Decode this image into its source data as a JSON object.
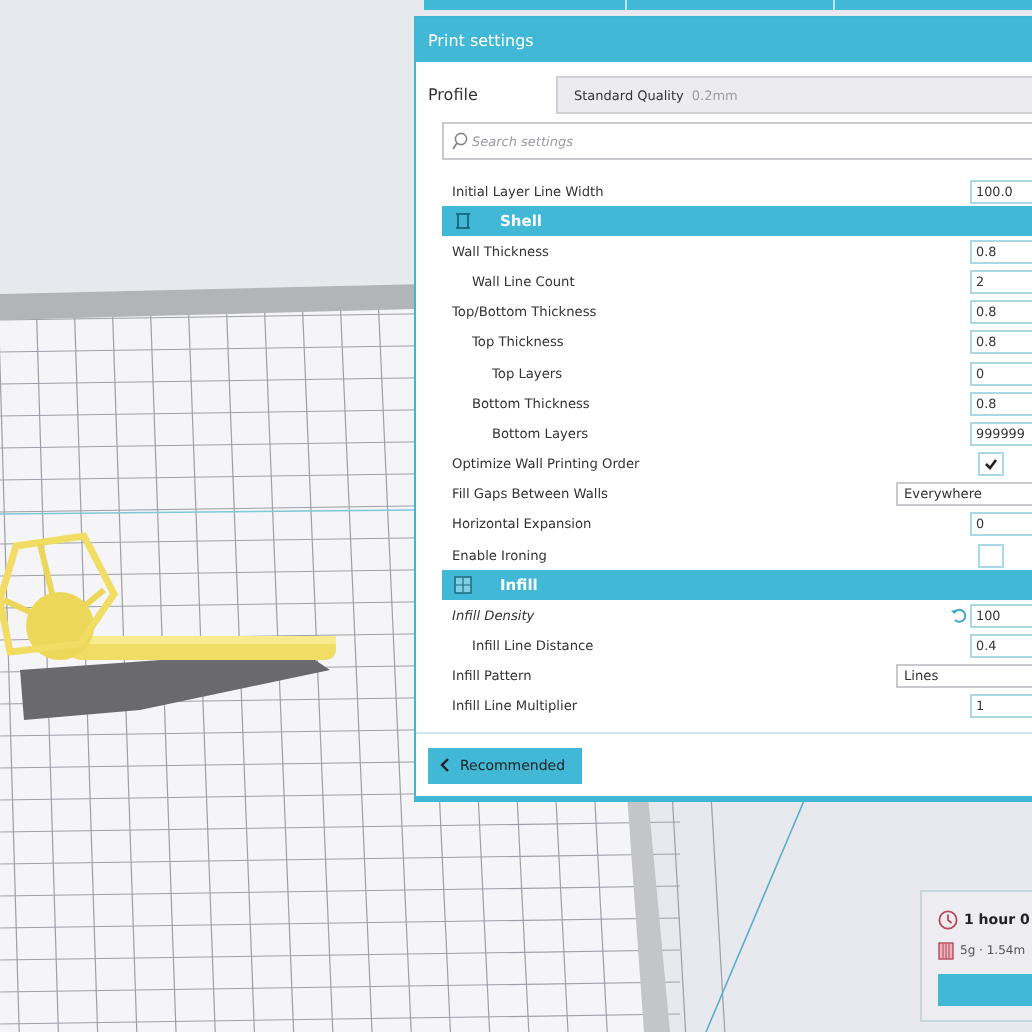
{
  "panel": {
    "title": "Print settings",
    "profile_label": "Profile",
    "profile": {
      "name": "Standard Quality",
      "detail": "0.2mm"
    },
    "search": {
      "placeholder": "Search settings"
    },
    "settings": [
      {
        "kind": "number",
        "label": "Initial Layer Line Width",
        "value": "100.0",
        "overridden": false
      },
      {
        "kind": "header",
        "label": "Shell"
      },
      {
        "kind": "number",
        "label": "Wall Thickness",
        "value": "0.8",
        "overridden": false,
        "children": [
          {
            "kind": "number",
            "label": "Wall Line Count",
            "value": "2",
            "overridden": false
          }
        ]
      },
      {
        "kind": "number",
        "label": "Top/Bottom Thickness",
        "value": "0.8",
        "overridden": false,
        "children": [
          {
            "kind": "number",
            "label": "Top Thickness",
            "value": "0.8",
            "overridden": false,
            "children": [
              {
                "kind": "number",
                "label": "Top Layers",
                "value": "0",
                "overridden": false
              }
            ]
          },
          {
            "kind": "number",
            "label": "Bottom Thickness",
            "value": "0.8",
            "overridden": false,
            "children": [
              {
                "kind": "number",
                "label": "Bottom Layers",
                "value": "999999",
                "overridden": false
              }
            ]
          }
        ]
      },
      {
        "kind": "checkbox",
        "label": "Optimize Wall Printing Order",
        "checked": true,
        "overridden": false
      },
      {
        "kind": "dropdown",
        "label": "Fill Gaps Between Walls",
        "value": "Everywhere",
        "overridden": false
      },
      {
        "kind": "number",
        "label": "Horizontal Expansion",
        "value": "0",
        "overridden": false
      },
      {
        "kind": "checkbox",
        "label": "Enable Ironing",
        "checked": false,
        "overridden": false
      },
      {
        "kind": "header",
        "label": "Infill"
      },
      {
        "kind": "number",
        "label": "Infill Density",
        "value": "100",
        "overridden": true,
        "children": [
          {
            "kind": "number",
            "label": "Infill Line Distance",
            "value": "0.4",
            "overridden": false
          }
        ]
      },
      {
        "kind": "dropdown",
        "label": "Infill Pattern",
        "value": "Lines",
        "overridden": false
      },
      {
        "kind": "number",
        "label": "Infill Line Multiplier",
        "value": "1",
        "overridden": false
      }
    ],
    "recommended_button": "Recommended"
  },
  "print_info": {
    "time": "1 hour 0",
    "material": "5g · 1.54m"
  }
}
